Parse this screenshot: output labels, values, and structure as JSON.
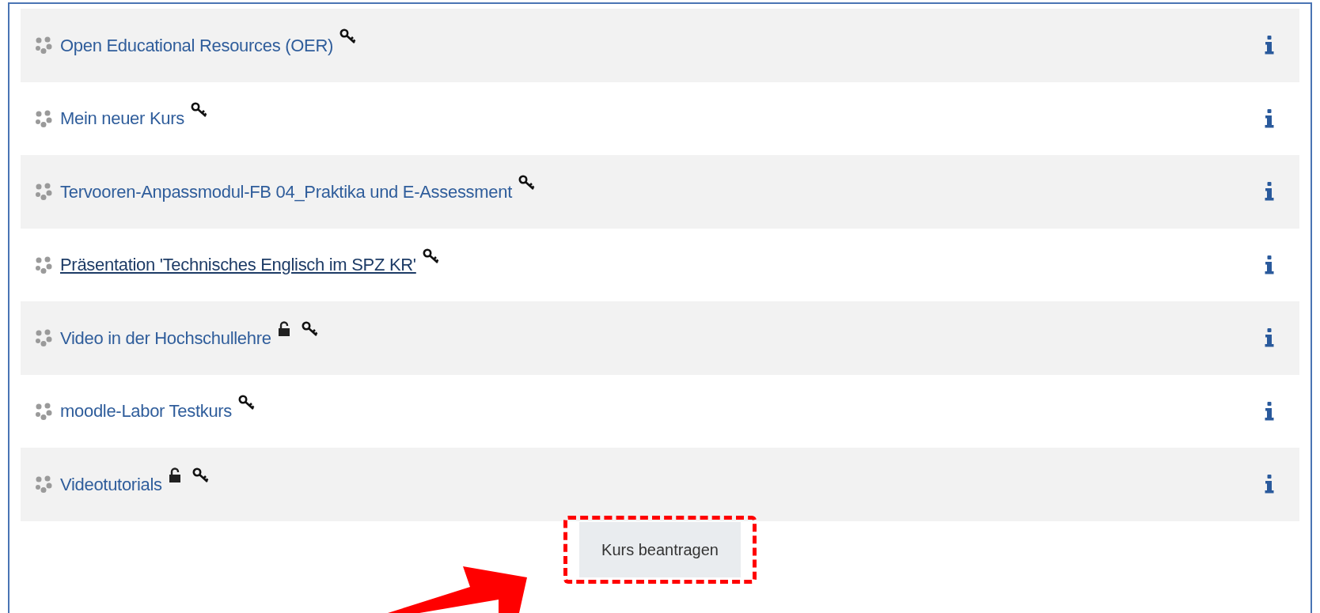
{
  "courses": [
    {
      "name": "Open Educational Resources (OER)",
      "hovered": false,
      "guest_access": false,
      "enrolment_key": true
    },
    {
      "name": "Mein neuer Kurs",
      "hovered": false,
      "guest_access": false,
      "enrolment_key": true
    },
    {
      "name": "Tervooren-Anpassmodul-FB 04_Praktika und E-Assessment",
      "hovered": false,
      "guest_access": false,
      "enrolment_key": true
    },
    {
      "name": "Präsentation 'Technisches Englisch im SPZ KR'",
      "hovered": true,
      "guest_access": false,
      "enrolment_key": true
    },
    {
      "name": "Video in der Hochschullehre",
      "hovered": false,
      "guest_access": true,
      "enrolment_key": true
    },
    {
      "name": "moodle-Labor Testkurs",
      "hovered": false,
      "guest_access": false,
      "enrolment_key": true
    },
    {
      "name": "Videotutorials",
      "hovered": false,
      "guest_access": true,
      "enrolment_key": true
    }
  ],
  "request_button": {
    "label": "Kurs beantragen"
  },
  "annotations": {
    "button_frame": true,
    "arrow": true
  }
}
